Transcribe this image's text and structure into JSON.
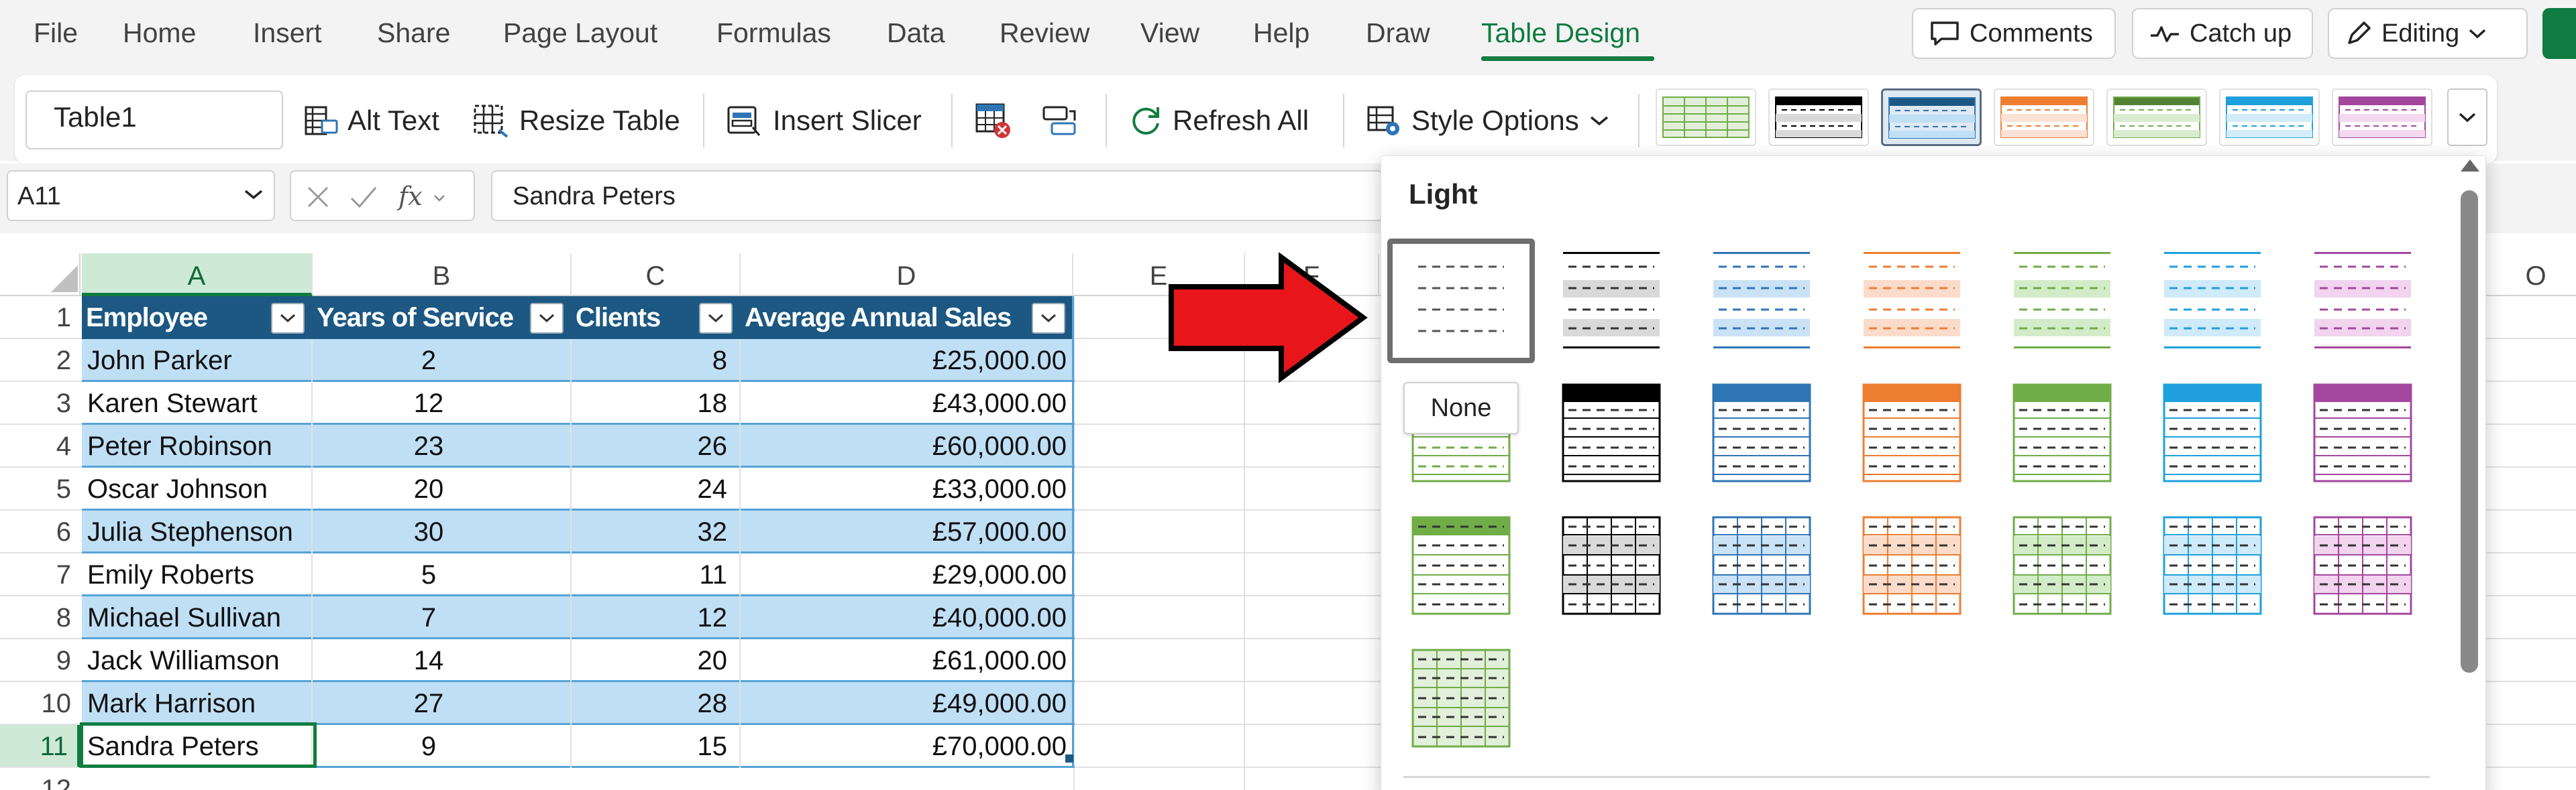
{
  "menu": {
    "items": [
      "File",
      "Home",
      "Insert",
      "Share",
      "Page Layout",
      "Formulas",
      "Data",
      "Review",
      "View",
      "Help",
      "Draw",
      "Table Design"
    ],
    "active": "Table Design",
    "comments_label": "Comments",
    "catchup_label": "Catch up",
    "editing_label": "Editing"
  },
  "ribbon": {
    "table_name": "Table1",
    "alt_text_label": "Alt Text",
    "resize_table_label": "Resize Table",
    "insert_slicer_label": "Insert Slicer",
    "refresh_all_label": "Refresh All",
    "style_options_label": "Style Options"
  },
  "formula_bar": {
    "name_box": "A11",
    "formula": "Sandra Peters"
  },
  "grid": {
    "columns": [
      "A",
      "B",
      "C",
      "D",
      "E",
      "F",
      "O"
    ],
    "rows": [
      "1",
      "2",
      "3",
      "4",
      "5",
      "6",
      "7",
      "8",
      "9",
      "10",
      "11",
      "12"
    ],
    "selected_column": "A",
    "selected_row": "11"
  },
  "table": {
    "headers": [
      "Employee",
      "Years of Service",
      "Clients",
      "Average Annual Sales"
    ],
    "rows": [
      [
        "John Parker",
        "2",
        "8",
        "£25,000.00"
      ],
      [
        "Karen Stewart",
        "12",
        "18",
        "£43,000.00"
      ],
      [
        "Peter Robinson",
        "23",
        "26",
        "£60,000.00"
      ],
      [
        "Oscar Johnson",
        "20",
        "24",
        "£33,000.00"
      ],
      [
        "Julia Stephenson",
        "30",
        "32",
        "£57,000.00"
      ],
      [
        "Emily Roberts",
        "5",
        "11",
        "£29,000.00"
      ],
      [
        "Michael Sullivan",
        "7",
        "12",
        "£40,000.00"
      ],
      [
        "Jack Williamson",
        "14",
        "20",
        "£61,000.00"
      ],
      [
        "Mark Harrison",
        "27",
        "28",
        "£49,000.00"
      ],
      [
        "Sandra Peters",
        "9",
        "15",
        "£70,000.00"
      ]
    ]
  },
  "dropdown": {
    "section_label": "Light",
    "tooltip": "None"
  },
  "colors": {
    "accent": "#107c41",
    "table_header": "#1c5882",
    "band": "#bfdff5",
    "arrow": "#e8161b",
    "palette": [
      "#7f7f7f",
      "#000000",
      "#2e75b6",
      "#ed7d31",
      "#70ad47",
      "#1fa0dc",
      "#a3479e"
    ]
  }
}
